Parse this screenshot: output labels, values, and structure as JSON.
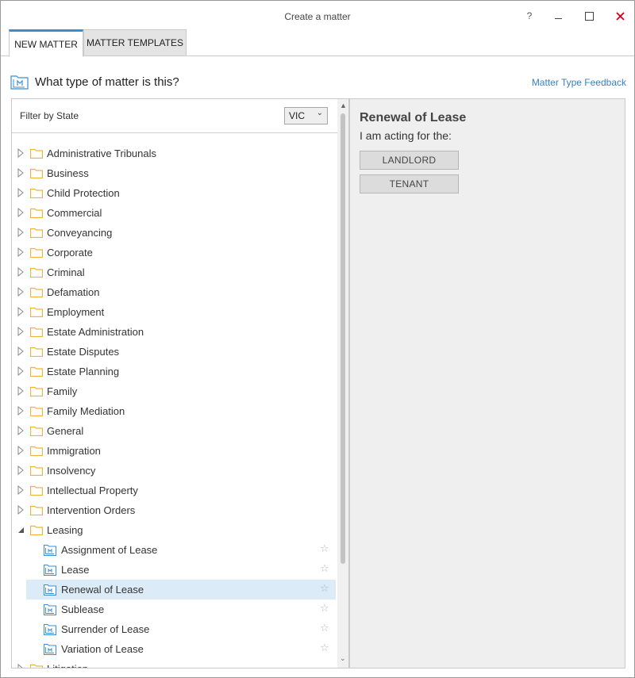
{
  "window": {
    "title": "Create a matter",
    "help_label": "?"
  },
  "tabs": [
    {
      "label": "NEW MATTER",
      "active": true
    },
    {
      "label": "MATTER TEMPLATES",
      "active": false
    }
  ],
  "header": {
    "question": "What type of matter is this?",
    "feedback_link": "Matter Type Feedback"
  },
  "filter": {
    "label": "Filter by State",
    "selected_state": "VIC"
  },
  "tree": {
    "categories": [
      "Administrative Tribunals",
      "Business",
      "Child Protection",
      "Commercial",
      "Conveyancing",
      "Corporate",
      "Criminal",
      "Defamation",
      "Employment",
      "Estate Administration",
      "Estate Disputes",
      "Estate Planning",
      "Family",
      "Family Mediation",
      "General",
      "Immigration",
      "Insolvency",
      "Intellectual Property",
      "Intervention Orders",
      "Leasing"
    ],
    "expanded_category": "Leasing",
    "leasing_children": [
      "Assignment of Lease",
      "Lease",
      "Renewal of Lease",
      "Sublease",
      "Surrender of Lease",
      "Variation of Lease"
    ],
    "selected_child": "Renewal of Lease",
    "next_category_partial": "Litigation"
  },
  "detail": {
    "title": "Renewal of Lease",
    "prompt": "I am acting for the:",
    "buttons": [
      "LANDLORD",
      "TENANT"
    ]
  },
  "colors": {
    "accent": "#3a8ed6",
    "link": "#3a7fc1",
    "folder": "#f0b43c",
    "matter_icon": "#3a8ed6",
    "close": "#d0021b",
    "selection": "#dcebf8"
  }
}
